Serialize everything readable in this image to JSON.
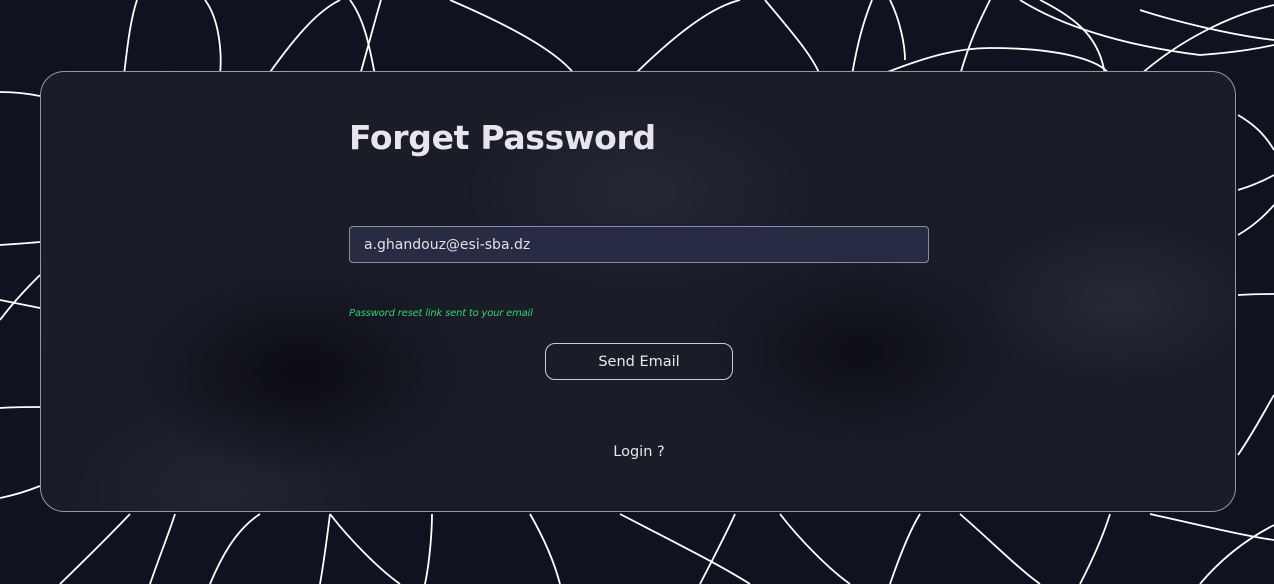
{
  "form": {
    "title": "Forget Password",
    "email_value": "a.ghandouz@esi-sba.dz",
    "status_message": "Password reset link sent to your email",
    "send_button_label": "Send Email",
    "login_link_label": "Login ?"
  },
  "colors": {
    "background": "#10121f",
    "card": "#1a1c28",
    "input_fill": "#282b44",
    "success_text": "#2fd36b",
    "line": "#ffffff"
  }
}
